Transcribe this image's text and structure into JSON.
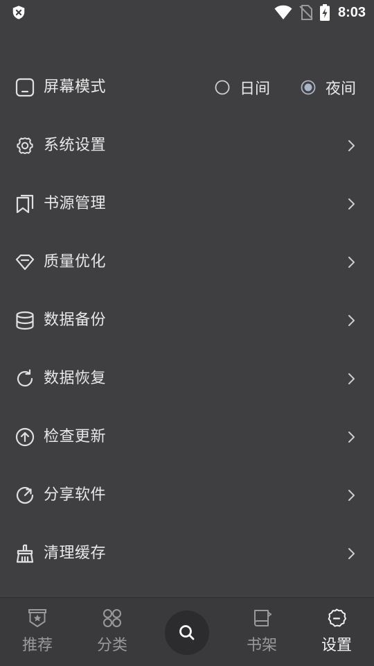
{
  "status_bar": {
    "time": "8:03",
    "icons": [
      "shield-x-icon",
      "wifi-icon",
      "no-sim-icon",
      "battery-charging-icon"
    ]
  },
  "menu": {
    "screen_mode": {
      "label": "屏幕模式",
      "options": [
        {
          "label": "日间",
          "selected": false
        },
        {
          "label": "夜间",
          "selected": true
        }
      ]
    },
    "items": [
      {
        "label": "系统设置",
        "icon": "gear-icon"
      },
      {
        "label": "书源管理",
        "icon": "bookmark-icon"
      },
      {
        "label": "质量优化",
        "icon": "diamond-icon"
      },
      {
        "label": "数据备份",
        "icon": "database-icon"
      },
      {
        "label": "数据恢复",
        "icon": "refresh-icon"
      },
      {
        "label": "检查更新",
        "icon": "upload-circle-icon"
      },
      {
        "label": "分享软件",
        "icon": "share-rotate-icon"
      },
      {
        "label": "清理缓存",
        "icon": "broom-icon"
      }
    ]
  },
  "bottom_nav": {
    "items": [
      {
        "label": "推荐",
        "icon": "recommend-icon",
        "active": false
      },
      {
        "label": "分类",
        "icon": "category-icon",
        "active": false
      },
      {
        "label": "",
        "icon": "search-icon",
        "active": false
      },
      {
        "label": "书架",
        "icon": "bookshelf-icon",
        "active": false
      },
      {
        "label": "设置",
        "icon": "settings-icon",
        "active": true
      }
    ]
  },
  "colors": {
    "background": "#3f3f41",
    "text": "#e8e8e8",
    "muted": "#9a9a9c",
    "search_bg": "#2c2c2e"
  }
}
